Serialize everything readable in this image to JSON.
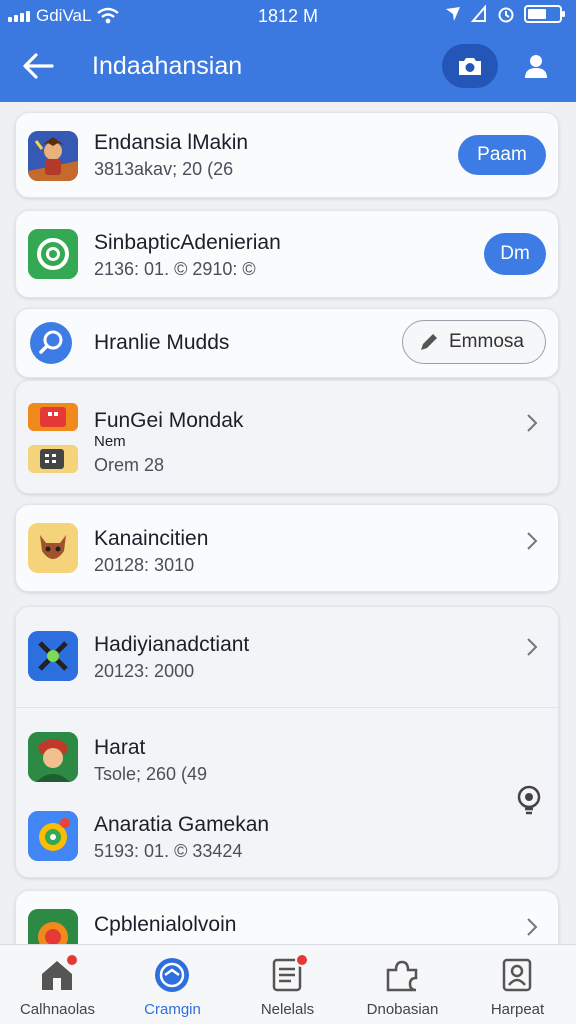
{
  "status_bar": {
    "carrier": "GdiVaL",
    "time": "1812 M"
  },
  "header": {
    "title": "Indaahansian",
    "accent": "#3b78e0"
  },
  "items": [
    {
      "title": "Endansia lMakin",
      "sub": "3813akav; 20 (26",
      "action": "Paam",
      "icon": "game-hero-icon"
    },
    {
      "title": "SinbapticAdenierian",
      "sub": "2136: 01.  © 2910: ©",
      "action": "Dm",
      "icon": "target-ring-icon"
    },
    {
      "title": "Hranlie Mudds",
      "action": "Emmosa",
      "icon": "search-icon"
    },
    {
      "title": "FunGei Mondak",
      "sub_top": "Nem",
      "sub": "Orem 28",
      "icon": "stacked-apps-icon"
    },
    {
      "title": "Kanaincitien",
      "sub": "20128: 3010",
      "icon": "creature-icon"
    },
    {
      "title": "Hadiyianadctiant",
      "sub": "20123: 2000",
      "icon": "crossed-tools-icon"
    },
    {
      "title": "Harat",
      "sub": "Tsole; 260 (49",
      "icon": "character-portrait-icon"
    },
    {
      "title": "Anaratia Gamekan",
      "sub": "5193: 01.  © 33424",
      "icon": "colorful-target-icon"
    },
    {
      "title": "Cpblenialolvoin",
      "sub": "",
      "icon": "orange-ball-icon"
    }
  ],
  "tabs": [
    {
      "label": "Calhnaolas",
      "icon": "home-icon",
      "badge": true
    },
    {
      "label": "Cramgin",
      "icon": "compass-icon",
      "active": true
    },
    {
      "label": "Nelelals",
      "icon": "list-icon",
      "badge": true
    },
    {
      "label": "Dnobasian",
      "icon": "puzzle-icon"
    },
    {
      "label": "Harpeat",
      "icon": "profile-card-icon"
    }
  ]
}
